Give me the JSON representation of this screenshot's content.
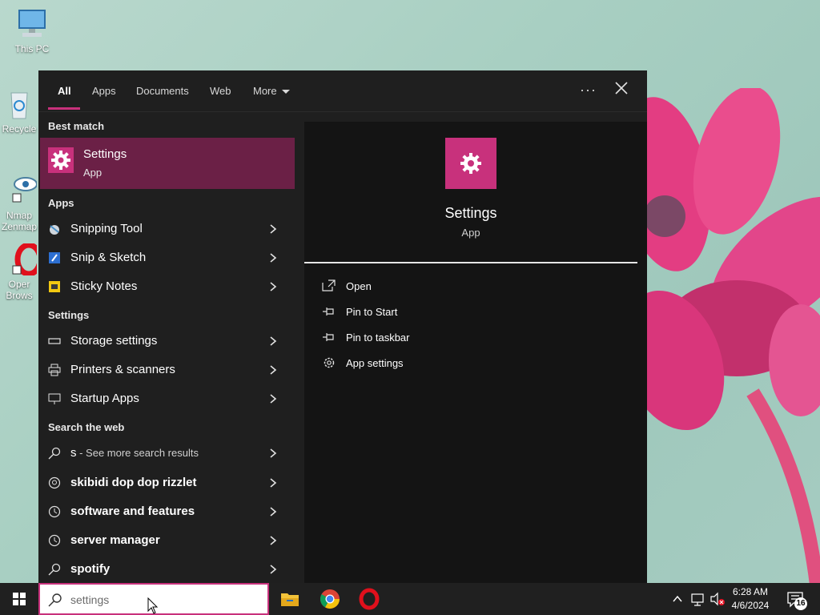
{
  "desktop": {
    "icons": [
      {
        "label": "This PC"
      },
      {
        "label": "Recycle"
      },
      {
        "label": "Nmap"
      },
      {
        "label": "Zenmap"
      },
      {
        "label": "Oper"
      },
      {
        "label": "Brows"
      }
    ]
  },
  "search_panel": {
    "tabs": {
      "all": "All",
      "apps": "Apps",
      "documents": "Documents",
      "web": "Web",
      "more": "More"
    },
    "options_icon": "ellipsis-icon",
    "close_icon": "close-icon",
    "best_match": {
      "heading": "Best match",
      "title": "Settings",
      "subtitle": "App",
      "icon": "gear-icon"
    },
    "apps_section": {
      "heading": "Apps",
      "items": [
        {
          "label": "Snipping Tool",
          "icon": "snipping-tool-icon"
        },
        {
          "label": "Snip & Sketch",
          "icon": "snip-sketch-icon"
        },
        {
          "label": "Sticky Notes",
          "icon": "sticky-notes-icon"
        }
      ]
    },
    "settings_section": {
      "heading": "Settings",
      "items": [
        {
          "label": "Storage settings",
          "icon": "storage-icon"
        },
        {
          "label": "Printers & scanners",
          "icon": "printer-icon"
        },
        {
          "label": "Startup Apps",
          "icon": "startup-icon"
        }
      ]
    },
    "web_section": {
      "heading": "Search the web",
      "items": [
        {
          "label": "s",
          "suffix": " - See more search results",
          "icon": "search-icon"
        },
        {
          "label": "skibidi dop dop rizzlet",
          "icon": "chat-search-icon"
        },
        {
          "label": "software and features",
          "icon": "history-icon"
        },
        {
          "label": "server manager",
          "icon": "history-icon"
        },
        {
          "label": "spotify",
          "icon": "search-icon"
        }
      ]
    },
    "preview": {
      "title": "Settings",
      "subtitle": "App",
      "actions": [
        {
          "label": "Open",
          "icon": "open-icon"
        },
        {
          "label": "Pin to Start",
          "icon": "pin-icon"
        },
        {
          "label": "Pin to taskbar",
          "icon": "pin-icon"
        },
        {
          "label": "App settings",
          "icon": "gear-icon"
        }
      ]
    }
  },
  "taskbar": {
    "search_value": "settings",
    "pinned_apps": [
      "file-explorer-icon",
      "chrome-icon",
      "opera-icon"
    ],
    "clock_time": "6:28 AM",
    "clock_date": "4/6/2024",
    "notification_count": "16"
  },
  "colors": {
    "accent": "#c8317c",
    "highlight": "#6b2046",
    "panel_bg": "#1f1f1f",
    "preview_bg": "#141414",
    "taskbar_bg": "#202020"
  }
}
